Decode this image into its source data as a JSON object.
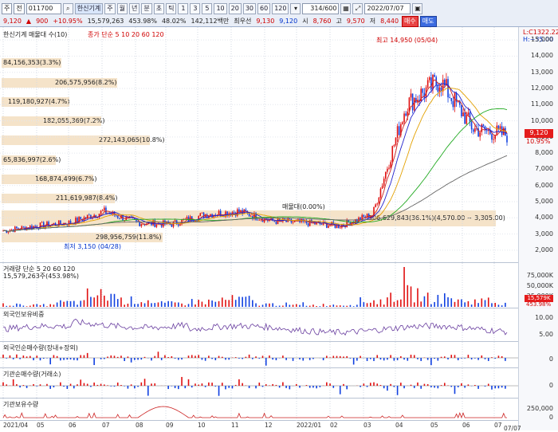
{
  "toolbar": {
    "market": "주",
    "ticker_type": "전",
    "code": "011700",
    "name": "한신기계",
    "periods": [
      "주",
      "월",
      "년",
      "분",
      "초",
      "틱"
    ],
    "tick_buttons": [
      "1",
      "3",
      "5",
      "10",
      "20",
      "30",
      "60",
      "120"
    ],
    "range": "314/600",
    "date": "2022/07/07",
    "price": "9,120",
    "change": "900",
    "change_pct": "+10.95%",
    "volume": "15,579,263",
    "vol_pct": "453.98%",
    "turnover_pct": "48.02%",
    "amount": "142,112백만",
    "high_label": "최우선",
    "high_val": "9,130",
    "bid_val": "9,120",
    "open_label": "시",
    "open_val": "8,760",
    "hi_label": "고",
    "hi_val": "9,570",
    "lo_label": "저",
    "lo_val": "8,440",
    "buy": "매수",
    "sell": "매도"
  },
  "price_panel": {
    "legend": "한신기계 매물대 수(10)",
    "ma_legend": "종가 단순 5 10 20 60 120",
    "max_label": "최고 14,950 (05/04)",
    "min_label": "최저 3,150 (04/28)",
    "cross_label": "매물대(0.00%)",
    "right_top1": "L:C1322.22",
    "right_top2": "H:~35.00",
    "current_price": "9,120",
    "current_pct": "10.95%",
    "bands": [
      {
        "text": "84,156,353(3.3%)"
      },
      {
        "text": "206,575,956(8.2%)"
      },
      {
        "text": "119,180,927(4.7%)"
      },
      {
        "text": "182,055,369(7.2%)"
      },
      {
        "text": "272,143,065(10.8%)"
      },
      {
        "text": "65,836,997(2.6%)"
      },
      {
        "text": "168,874,499(6.7%)"
      },
      {
        "text": "211,619,987(8.4%)"
      },
      {
        "text": "906,629,843(36.1%)(4,570.00 ~ 3,305.00)"
      },
      {
        "text": "298,956,759(11.8%)"
      }
    ]
  },
  "volume_panel": {
    "legend": "거래량 단순 5 20 60 120",
    "current": "15,579,263주(453.98%)",
    "current_badge": "15,579K",
    "pct_badge": "453.98%"
  },
  "foreign_panel": {
    "legend": "외국인보유비중"
  },
  "foreign_net_panel": {
    "legend": "외국인순매수량(장내+장외)"
  },
  "inst_net_panel": {
    "legend": "기관순매수량(거래소)"
  },
  "inst_hold_panel": {
    "legend": "기관보유수량"
  },
  "axis": {
    "price_ticks": [
      "15,000",
      "14,000",
      "13,000",
      "12,000",
      "11,000",
      "10,000",
      "9,000",
      "8,000",
      "7,000",
      "6,000",
      "5,000",
      "4,000",
      "3,000",
      "2,000"
    ],
    "volume_ticks": [
      "75,000K",
      "50,000K",
      "25,000K"
    ],
    "foreign_ticks": [
      "10.00",
      "5.00"
    ],
    "net_tick": "0",
    "inst_tick": "0",
    "hold_ticks": [
      "250,000",
      "0"
    ],
    "x_dates": [
      "2021/04",
      "05",
      "06",
      "07",
      "08",
      "09",
      "10",
      "11",
      "12",
      "2022/01",
      "02",
      "03",
      "04",
      "05",
      "06",
      "07",
      "07/07"
    ]
  },
  "chart_data": {
    "type": "line",
    "title": "한신기계",
    "x": [
      "2021-04",
      "2021-05",
      "2021-06",
      "2021-07",
      "2021-08",
      "2021-09",
      "2021-10",
      "2021-11",
      "2021-12",
      "2022-01",
      "2022-02",
      "2022-03",
      "2022-04",
      "2022-05",
      "2022-06",
      "2022-07"
    ],
    "series": [
      {
        "name": "종가",
        "values": [
          3200,
          3500,
          3700,
          4400,
          3700,
          3600,
          4200,
          4400,
          3800,
          3700,
          3500,
          4200,
          11000,
          12500,
          9500,
          9120
        ]
      }
    ],
    "ylim": [
      1500,
      15500
    ],
    "volume_series": [
      8000,
      6000,
      15000,
      40000,
      22000,
      12000,
      18000,
      25000,
      9000,
      6000,
      7000,
      20000,
      45000,
      30000,
      20000,
      15579
    ],
    "volume_unit": "K"
  }
}
